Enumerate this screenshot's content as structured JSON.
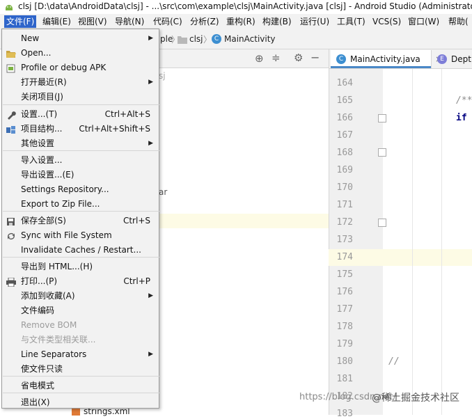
{
  "window": {
    "title": "clsj [D:\\data\\AndroidData\\clsj] - ...\\src\\com\\example\\clsj\\MainActivity.java [clsj] - Android Studio (Administrator)"
  },
  "menubar": {
    "items": [
      "文件(F)",
      "编辑(E)",
      "视图(V)",
      "导航(N)",
      "代码(C)",
      "分析(Z)",
      "重构(R)",
      "构建(B)",
      "运行(U)",
      "工具(T)",
      "VCS(S)",
      "窗口(W)",
      "帮助("
    ]
  },
  "navbar": {
    "crumbs": [
      "ple",
      "clsj",
      "MainActivity"
    ]
  },
  "project_panel": {
    "partial_texts": [
      "sj",
      "ar"
    ],
    "bottom_item": "strings.xml"
  },
  "editor": {
    "tabs": [
      "MainActivity.java",
      "DeptE"
    ],
    "line_numbers": [
      "164",
      "165",
      "166",
      "167",
      "168",
      "169",
      "170",
      "171",
      "172",
      "173",
      "174",
      "175",
      "176",
      "177",
      "178",
      "179",
      "180",
      "181",
      "182",
      "183"
    ],
    "code": {
      "comment_165": "/**",
      "if_166": "if",
      "comment_180": "//"
    }
  },
  "file_menu": {
    "items": [
      {
        "label": "New",
        "shortcut": "",
        "submenu": true,
        "icon": ""
      },
      {
        "label": "Open...",
        "shortcut": "",
        "submenu": false,
        "icon": "folder-icon"
      },
      {
        "label": "Profile or debug APK",
        "shortcut": "",
        "submenu": false,
        "icon": "apk-icon"
      },
      {
        "label": "打开最近(R)",
        "shortcut": "",
        "submenu": true,
        "icon": ""
      },
      {
        "label": "关闭项目(J)",
        "shortcut": "",
        "submenu": false,
        "icon": ""
      },
      {
        "label": "设置...(T)",
        "shortcut": "Ctrl+Alt+S",
        "submenu": false,
        "icon": "wrench-icon"
      },
      {
        "label": "项目结构...",
        "shortcut": "Ctrl+Alt+Shift+S",
        "submenu": false,
        "icon": "project-structure-icon"
      },
      {
        "label": "其他设置",
        "shortcut": "",
        "submenu": true,
        "icon": ""
      },
      {
        "label": "导入设置...",
        "shortcut": "",
        "submenu": false,
        "icon": ""
      },
      {
        "label": "导出设置...(E)",
        "shortcut": "",
        "submenu": false,
        "icon": ""
      },
      {
        "label": "Settings Repository...",
        "shortcut": "",
        "submenu": false,
        "icon": ""
      },
      {
        "label": "Export to Zip File...",
        "shortcut": "",
        "submenu": false,
        "icon": ""
      },
      {
        "label": "保存全部(S)",
        "shortcut": "Ctrl+S",
        "submenu": false,
        "icon": "save-icon"
      },
      {
        "label": "Sync with File System",
        "shortcut": "",
        "submenu": false,
        "icon": "sync-icon"
      },
      {
        "label": "Invalidate Caches / Restart...",
        "shortcut": "",
        "submenu": false,
        "icon": ""
      },
      {
        "label": "导出到 HTML...(H)",
        "shortcut": "",
        "submenu": false,
        "icon": ""
      },
      {
        "label": "打印...(P)",
        "shortcut": "Ctrl+P",
        "submenu": false,
        "icon": "print-icon"
      },
      {
        "label": "添加到收藏(A)",
        "shortcut": "",
        "submenu": true,
        "icon": ""
      },
      {
        "label": "文件编码",
        "shortcut": "",
        "submenu": false,
        "icon": ""
      },
      {
        "label": "Remove BOM",
        "shortcut": "",
        "submenu": false,
        "icon": "",
        "disabled": true
      },
      {
        "label": "与文件类型相关联...",
        "shortcut": "",
        "submenu": false,
        "icon": "",
        "disabled": true
      },
      {
        "label": "Line Separators",
        "shortcut": "",
        "submenu": true,
        "icon": ""
      },
      {
        "label": "使文件只读",
        "shortcut": "",
        "submenu": false,
        "icon": ""
      },
      {
        "label": "省电模式",
        "shortcut": "",
        "submenu": false,
        "icon": ""
      },
      {
        "label": "退出(X)",
        "shortcut": "",
        "submenu": false,
        "icon": ""
      }
    ]
  },
  "watermark": {
    "url": "https://blog.csdn.net/",
    "brand": "@稀土掘金技术社区"
  },
  "colors": {
    "menu_active": "#2f65ca",
    "menu_bg": "#f2f2f2",
    "highlight_line": "#fdfbe5",
    "tab_underline": "#4a88c7",
    "java_class_icon": "#3d8fd1",
    "enum_icon": "#7e7ed8"
  }
}
